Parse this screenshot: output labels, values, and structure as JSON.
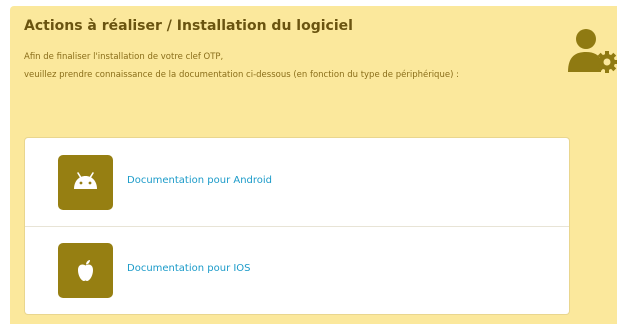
{
  "panel": {
    "title": "Actions à réaliser / Installation du logiciel",
    "description_line1": "Afin de finaliser l'installation de votre clef OTP,",
    "description_line2": "veuillez prendre connaissance de la documentation ci-dessous (en fonction du type de périphérique) :",
    "header_icon": "user-gear-icon"
  },
  "docs": [
    {
      "icon": "android-icon",
      "label": "Documentation pour Android"
    },
    {
      "icon": "apple-icon",
      "label": "Documentation pour IOS"
    }
  ],
  "colors": {
    "panel_bg": "#fbe89c",
    "title": "#6a5410",
    "icon_tile": "#967f12",
    "link": "#1c9bc9"
  }
}
